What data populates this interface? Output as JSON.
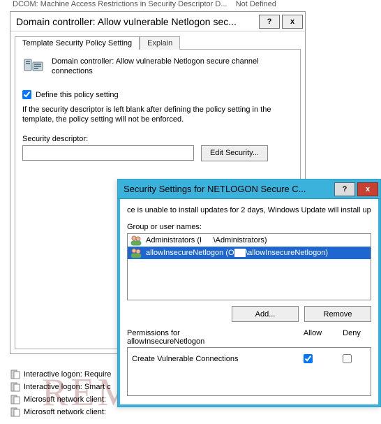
{
  "top_row": {
    "label": "DCOM: Machine Access Restrictions in Security Descriptor D...",
    "value": "Not Defined"
  },
  "win1": {
    "title": "Domain controller: Allow vulnerable Netlogon sec...",
    "help_btn": "?",
    "close_btn": "x",
    "tab_template": "Template Security Policy Setting",
    "tab_explain": "Explain",
    "policy_name": "Domain controller: Allow vulnerable Netlogon secure channel connections",
    "define_label": "Define this policy setting",
    "define_checked": true,
    "note": "If the security descriptor is left blank after defining the policy setting in the template, the policy setting will not be enforced.",
    "sd_label": "Security descriptor:",
    "sd_value": "",
    "edit_btn": "Edit Security..."
  },
  "win2": {
    "title": "Security Settings for NETLOGON Secure C...",
    "help_btn": "?",
    "close_btn": "x",
    "wu_line": "ce is unable to install updates for 2 days, Windows Update will install upd",
    "group_label": "Group or user names:",
    "items": [
      {
        "icon": "group-icon",
        "text": "Administrators (I███\\Administrators)",
        "selected": false
      },
      {
        "icon": "group-icon",
        "text": "allowInsecureNetlogon (O███\\allowInsecureNetlogon)",
        "selected": true
      }
    ],
    "add_btn": "Add...",
    "remove_btn": "Remove",
    "perm_label_prefix": "Permissions for",
    "perm_subject": "allowInsecureNetlogon",
    "col_allow": "Allow",
    "col_deny": "Deny",
    "perms": [
      {
        "name": "Create Vulnerable Connections",
        "allow": true,
        "deny": false
      }
    ]
  },
  "bg_items": [
    "Interactive logon: Require",
    "Interactive logon: Smart c",
    "Microsoft network client:",
    "Microsoft network client:"
  ],
  "watermark": "REMONTKA.COM"
}
